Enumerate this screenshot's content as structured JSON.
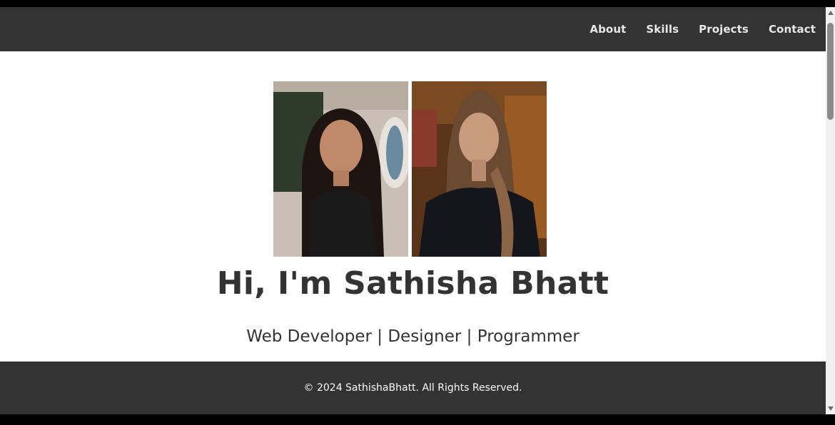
{
  "nav": {
    "items": [
      {
        "label": "About"
      },
      {
        "label": "Skills"
      },
      {
        "label": "Projects"
      },
      {
        "label": "Contact"
      }
    ]
  },
  "hero": {
    "title": "Hi, I'm Sathisha Bhatt",
    "subtitle": "Web Developer | Designer | Programmer"
  },
  "footer": {
    "text": "© 2024 SathishaBhatt. All Rights Reserved."
  },
  "colors": {
    "navbar_bg": "#333333",
    "footer_bg": "#333333",
    "text_dark": "#333333",
    "page_bg": "#ffffff"
  }
}
